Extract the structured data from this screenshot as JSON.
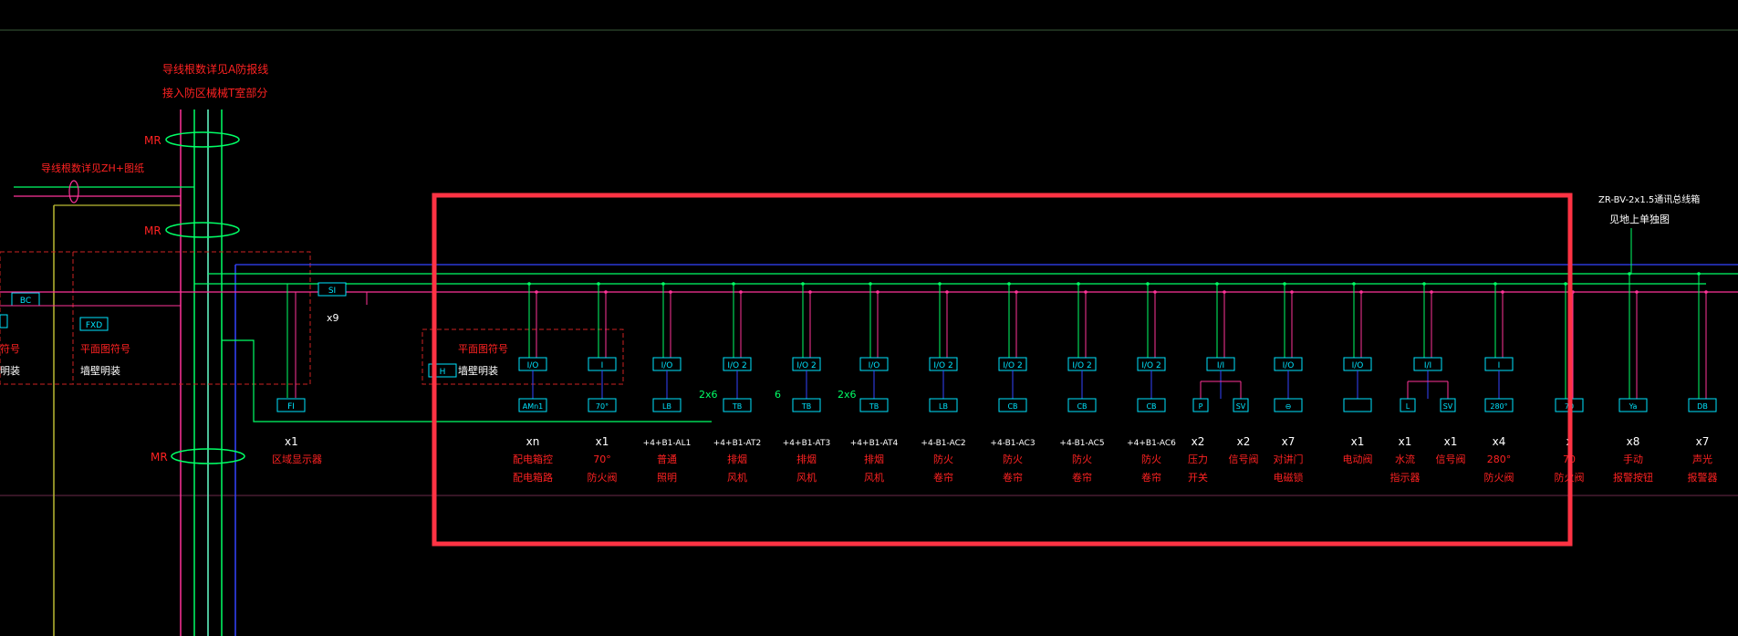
{
  "colors": {
    "background": "#000000",
    "green_wire": "#00ff66",
    "magenta_wire": "#ff3399",
    "blue_wire": "#3344ff",
    "cyan_box": "#00e5ff",
    "red_text": "#ff2222",
    "white_text": "#ffffff",
    "yellow_wire": "#bbbb33",
    "highlight_frame": "#ff3344",
    "dashed_red": "#cc2222"
  },
  "top_notes": {
    "line1": "导线根数详见A防报线",
    "line2": "接入防区械械T室部分"
  },
  "left_note": "导线根数详见ZH+图纸",
  "mr_labels": [
    "MR",
    "MR",
    "MR"
  ],
  "left_devices": {
    "bc": "BC",
    "fxd": "FXD",
    "plan_symbol": "平面图符号",
    "plan_symbol_partial": "符号",
    "wall_mount": "墙壁明装",
    "wall_mount_partial": "明装"
  },
  "si_box": {
    "label": "SI",
    "count": "x9"
  },
  "fi_device": {
    "box": "FI",
    "qty": "x1",
    "desc": "区域显示器"
  },
  "legend_box": {
    "symbol": "H",
    "plan_symbol": "平面图符号",
    "wall_mount": "墙壁明装"
  },
  "wire_counts": [
    "2x6",
    "6",
    "2x6"
  ],
  "right_note": {
    "line1": "ZR-BV-2x1.5通讯总线箱",
    "line2": "见地上单独图"
  },
  "devices": [
    {
      "top": "I/O",
      "bottom": "AMn1",
      "qty": "xn",
      "line1": "配电箱控",
      "line2": "配电箱路"
    },
    {
      "top": "I",
      "bottom": "70°",
      "qty": "x1",
      "line1": "70°",
      "line2": "防火阀"
    },
    {
      "top": "I/O",
      "bottom": "LB",
      "qty": "+4+B1-AL1",
      "line1": "普通",
      "line2": "照明"
    },
    {
      "top": "I/O 2",
      "bottom": "TB",
      "qty": "+4+B1-AT2",
      "line1": "排烟",
      "line2": "风机"
    },
    {
      "top": "I/O 2",
      "bottom": "TB",
      "qty": "+4+B1-AT3",
      "line1": "排烟",
      "line2": "风机"
    },
    {
      "top": "I/O",
      "bottom": "TB",
      "qty": "+4+B1-AT4",
      "line1": "排烟",
      "line2": "风机"
    },
    {
      "top": "I/O 2",
      "bottom": "LB",
      "qty": "+4-B1-AC2",
      "line1": "防火",
      "line2": "卷帘"
    },
    {
      "top": "I/O 2",
      "bottom": "CB",
      "qty": "+4-B1-AC3",
      "line1": "防火",
      "line2": "卷帘"
    },
    {
      "top": "I/O 2",
      "bottom": "CB",
      "qty": "+4-B1-AC5",
      "line1": "防火",
      "line2": "卷帘"
    },
    {
      "top": "I/O 2",
      "bottom": "CB",
      "qty": "+4+B1-AC6",
      "line1": "防火",
      "line2": "卷帘"
    },
    {
      "top": "I/I",
      "bottom": "P",
      "bottom2": "SV",
      "qty": "x2",
      "qty2": "x2",
      "line1": "压力",
      "line2": "开关",
      "line1b": "信号阀",
      "line2b": ""
    },
    {
      "top": "I/O",
      "bottom": "⊖",
      "qty": "x7",
      "line1": "对讲门",
      "line2": "电磁锁"
    },
    {
      "top": "I/O",
      "bottom": "",
      "qty": "x1",
      "line1": "电动阀",
      "line2": ""
    },
    {
      "top": "I/I",
      "bottom": "L",
      "bottom2": "SV",
      "qty": "x1",
      "qty2": "x1",
      "line1": "水流",
      "line2": "指示器",
      "line1b": "信号阀",
      "line2b": ""
    },
    {
      "top": "I",
      "bottom": "280°",
      "qty": "x4",
      "line1": "280°",
      "line2": "防火阀"
    },
    {
      "top": "",
      "bottom": "70",
      "qty": "x",
      "line1": "70",
      "line2": "防火阀"
    },
    {
      "top": "",
      "bottom": "Ya",
      "qty": "x8",
      "line1": "手动",
      "line2": "报警按钮"
    },
    {
      "top": "",
      "bottom": "DB",
      "qty": "x7",
      "line1": "声光",
      "line2": "报警器"
    }
  ]
}
